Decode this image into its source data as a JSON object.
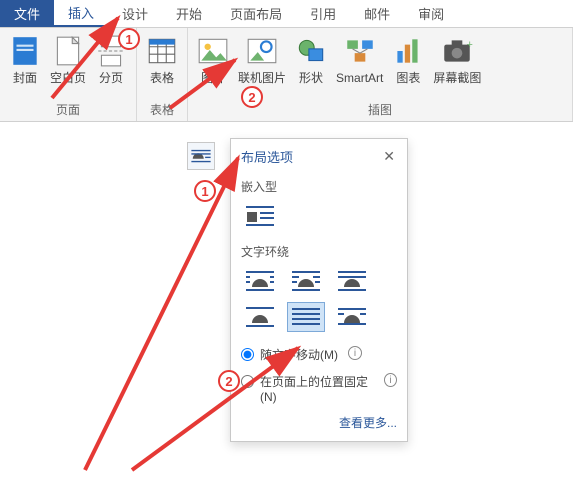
{
  "tabs": {
    "file": "文件",
    "insert": "插入",
    "design": "设计",
    "home": "开始",
    "pagelayout": "页面布局",
    "references": "引用",
    "mail": "邮件",
    "review": "审阅"
  },
  "groups": {
    "pages": {
      "label": "页面",
      "cover": "封面",
      "blank": "空白页",
      "break": "分页"
    },
    "tables": {
      "label": "表格",
      "table": "表格"
    },
    "illustrations": {
      "label": "插图",
      "picture": "图片",
      "online": "联机图片",
      "shapes": "形状",
      "smartart": "SmartArt",
      "chart": "图表",
      "screenshot": "屏幕截图"
    }
  },
  "panel": {
    "title": "布局选项",
    "inline": "嵌入型",
    "wrap": "文字环绕",
    "move_with_text": "随文字移动(M)",
    "fixed_on_page": "在页面上的位置固定(N)",
    "more": "查看更多...",
    "radio_selected": "move_with_text"
  },
  "annotations": {
    "top1": "1",
    "top2": "2",
    "panel1": "1",
    "panel2": "2"
  }
}
